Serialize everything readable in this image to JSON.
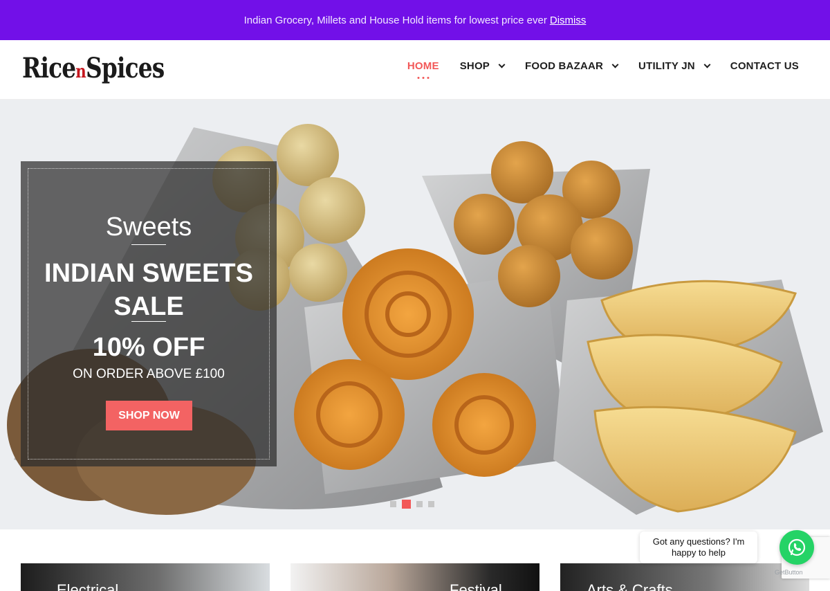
{
  "notice": {
    "text": "Indian Grocery, Millets and House Hold items for lowest price ever",
    "dismiss_label": "Dismiss"
  },
  "logo": {
    "part1": "Rice",
    "part2": "n",
    "part3": "Spices"
  },
  "nav": {
    "items": [
      {
        "label": "HOME",
        "active": true
      },
      {
        "label": "SHOP"
      },
      {
        "label": "FOOD BAZAAR"
      },
      {
        "label": "UTILITY JN"
      },
      {
        "label": "CONTACT US"
      }
    ]
  },
  "slide": {
    "subtitle": "Sweets",
    "title": "INDIAN SWEETS SALE",
    "discount": "10% OFF",
    "condition": "ON ORDER ABOVE £100",
    "button_label": "SHOP NOW",
    "pager": {
      "count": 4,
      "active_index": 1
    }
  },
  "tiles": [
    {
      "label": "Electrical"
    },
    {
      "label": "Festival"
    },
    {
      "label": "Arts & Crafts"
    }
  ],
  "chat": {
    "message": "Got any questions? I'm happy to help",
    "brand": "GetButton"
  },
  "colors": {
    "notice_bg": "#7210e8",
    "accent": "#f25858",
    "button": "#f36363",
    "whatsapp": "#25d366"
  }
}
